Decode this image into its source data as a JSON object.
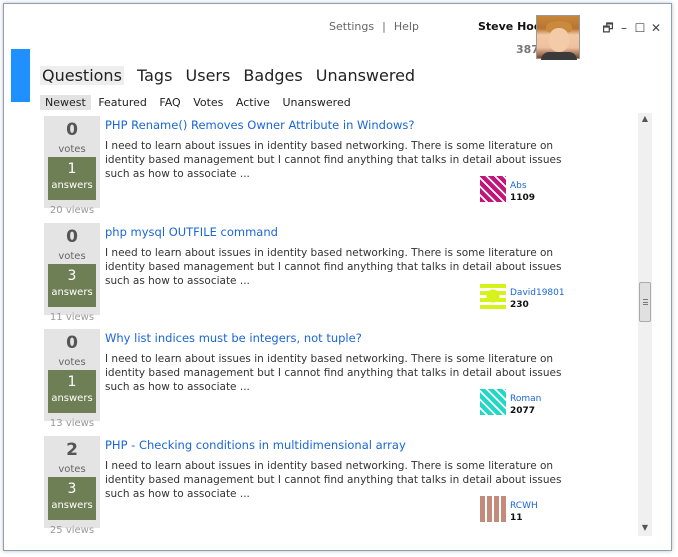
{
  "header": {
    "settings_label": "Settings",
    "separator": "|",
    "help_label": "Help",
    "user": {
      "name": "Steve Hook",
      "reputation": "387"
    },
    "window_controls": {
      "restore": "🗗",
      "minimize": "–",
      "maximize": "☐",
      "close": "✕"
    }
  },
  "main_tabs": [
    "Questions",
    "Tags",
    "Users",
    "Badges",
    "Unanswered"
  ],
  "sub_tabs": [
    "Newest",
    "Featured",
    "FAQ",
    "Votes",
    "Active",
    "Unanswered"
  ],
  "questions": [
    {
      "votes": "0",
      "votes_label": "votes",
      "answers": "1",
      "answers_label": "answers",
      "views": "20 views",
      "title": "PHP Rename() Removes Owner Attribute in Windows?",
      "excerpt": "I need to learn about issues in identity based networking. There is some literature on identity based management but I cannot find anything that talks in detail about issues such as how to associate ...",
      "user": "Abs",
      "user_rep": "1109"
    },
    {
      "votes": "0",
      "votes_label": "votes",
      "answers": "3",
      "answers_label": "answers",
      "views": "11 views",
      "title": "php mysql OUTFILE command",
      "excerpt": "I need to learn about issues in identity based networking. There is some literature on identity based management but I cannot find anything that talks in detail about issues such as how to associate ...",
      "user": "David19801",
      "user_rep": "230"
    },
    {
      "votes": "0",
      "votes_label": "votes",
      "answers": "1",
      "answers_label": "answers",
      "views": "13 views",
      "title": "Why list indices must be integers, not tuple?",
      "excerpt": "I need to learn about issues in identity based networking. There is some literature on identity based management but I cannot find anything that talks in detail about issues such as how to associate ...",
      "user": "Roman",
      "user_rep": "2077"
    },
    {
      "votes": "2",
      "votes_label": "votes",
      "answers": "3",
      "answers_label": "answers",
      "views": "25 views",
      "title": "PHP - Checking conditions in multidimensional array",
      "excerpt": "I need to learn about issues in identity based networking. There is some literature on identity based management but I cannot find anything that talks in detail about issues such as how to associate ...",
      "user": "RCWH",
      "user_rep": "11"
    }
  ],
  "scrollbar": {
    "up_arrow": "▲",
    "down_arrow": "▼"
  },
  "colors": {
    "accent": "#1e90ff",
    "answers_box": "#6f7f55",
    "link": "#1a66d6",
    "stat_box": "#e4e4e4"
  }
}
